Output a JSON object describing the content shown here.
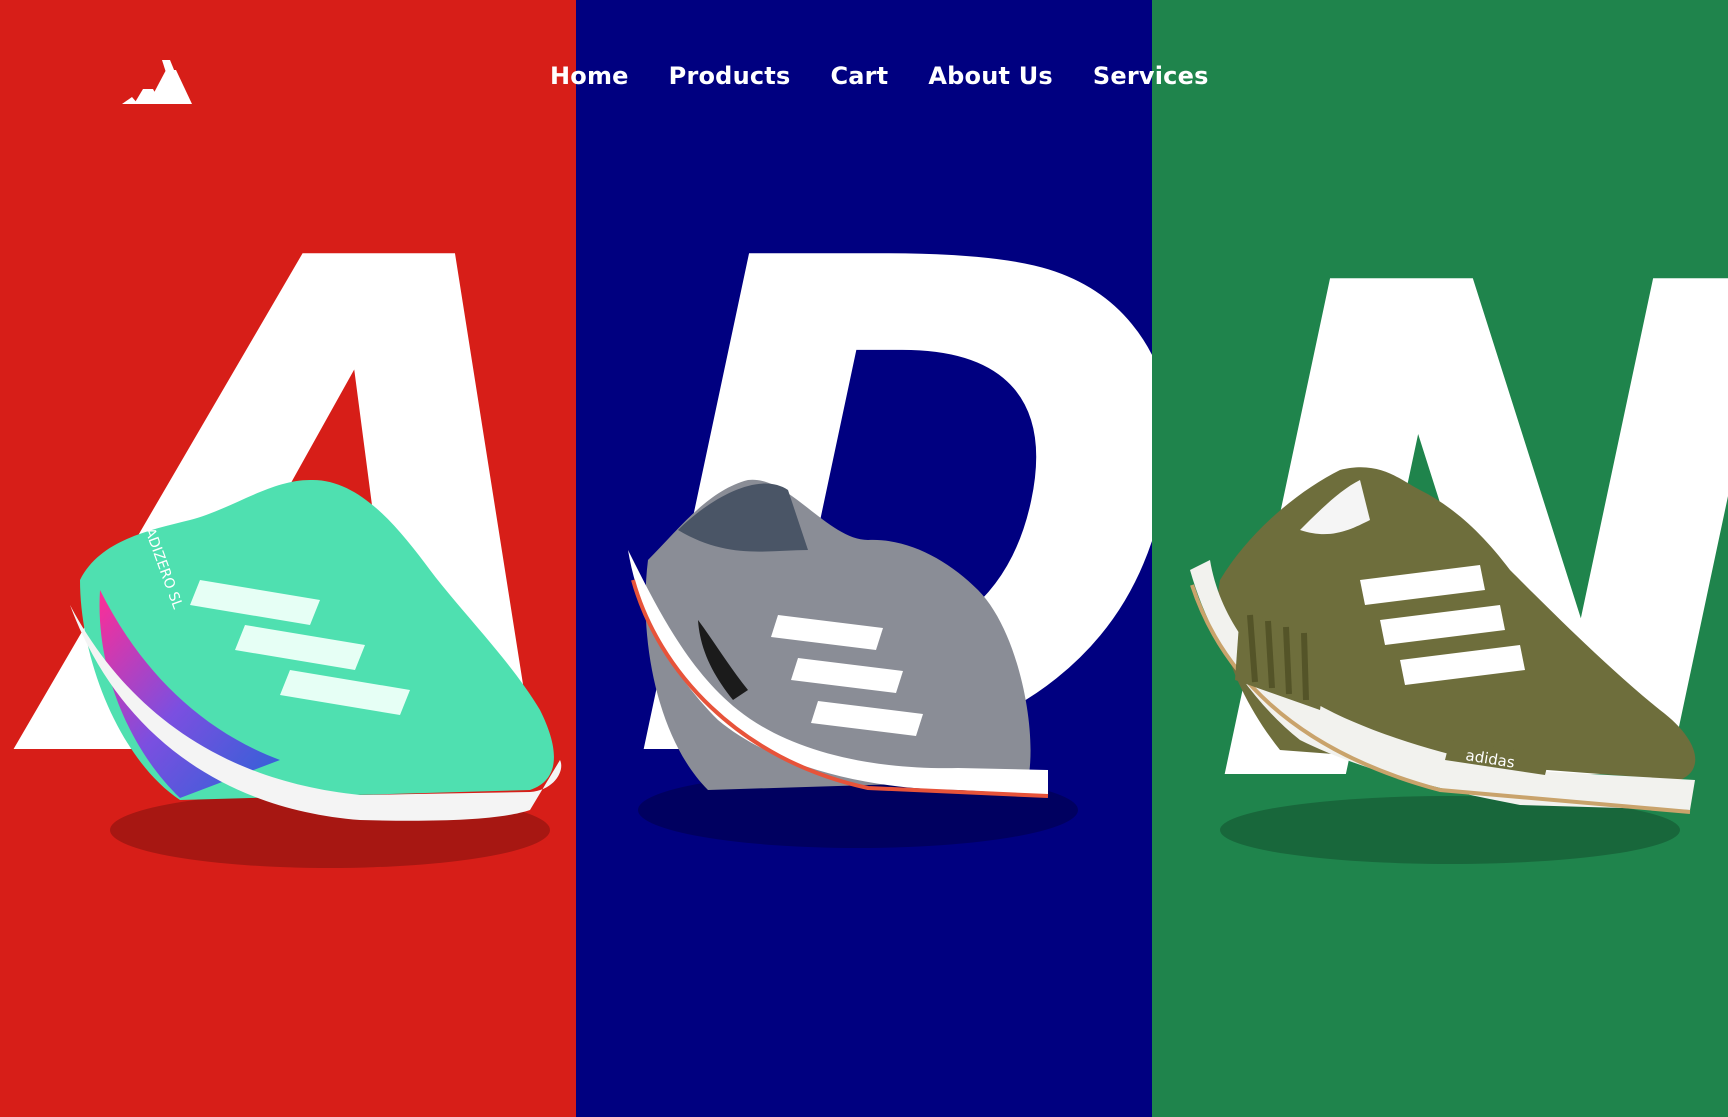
{
  "brand": {
    "logo": "adidas-logo-icon"
  },
  "nav": {
    "items": [
      {
        "label": "Home"
      },
      {
        "label": "Products"
      },
      {
        "label": "Cart"
      },
      {
        "label": "About Us"
      },
      {
        "label": "Services"
      }
    ]
  },
  "panels": [
    {
      "letter": "A",
      "bg": "#D71E18",
      "shoe": "teal-running-shoe-icon"
    },
    {
      "letter": "D",
      "bg": "#000080",
      "shoe": "grey-running-shoe-icon"
    },
    {
      "letter": "N",
      "bg": "#1F844C",
      "shoe": "olive-nmd-shoe-icon"
    }
  ],
  "shoe_prints": {
    "model": "ADIZERO SL",
    "wordmark": "adidas"
  }
}
